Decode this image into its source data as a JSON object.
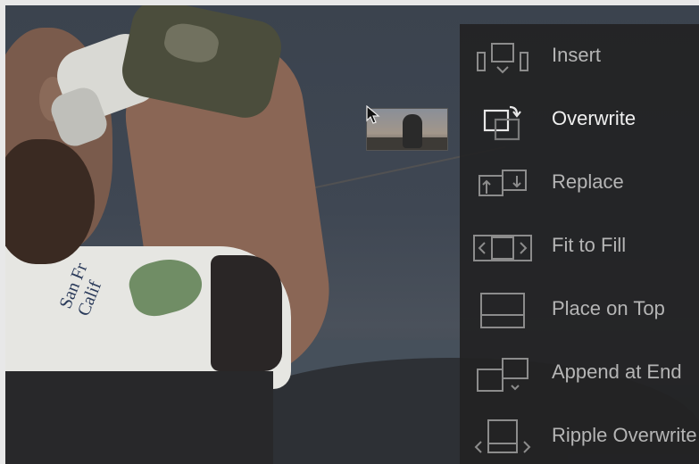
{
  "overlay_menu": {
    "items": [
      {
        "label": "Insert",
        "icon": "insert-icon",
        "active": false
      },
      {
        "label": "Overwrite",
        "icon": "overwrite-icon",
        "active": true
      },
      {
        "label": "Replace",
        "icon": "replace-icon",
        "active": false
      },
      {
        "label": "Fit to Fill",
        "icon": "fit-to-fill-icon",
        "active": false
      },
      {
        "label": "Place on Top",
        "icon": "place-on-top-icon",
        "active": false
      },
      {
        "label": "Append at End",
        "icon": "append-at-end-icon",
        "active": false
      },
      {
        "label": "Ripple Overwrite",
        "icon": "ripple-overwrite-icon",
        "active": false
      }
    ]
  },
  "jersey": {
    "text": "San Fr\nCalif"
  },
  "colors": {
    "menu_bg": "#222224",
    "label": "#b5b5b5",
    "label_active": "#f0f0f0",
    "icon": "#8c8c8c",
    "icon_active": "#e8e8e8"
  }
}
